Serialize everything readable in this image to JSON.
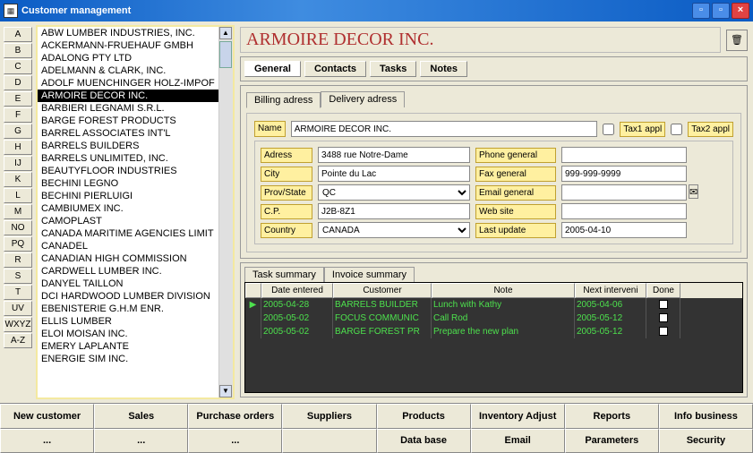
{
  "window": {
    "title": "Customer management"
  },
  "alphabet": [
    "A",
    "B",
    "C",
    "D",
    "E",
    "F",
    "G",
    "H",
    "IJ",
    "K",
    "L",
    "M",
    "NO",
    "PQ",
    "R",
    "S",
    "T",
    "UV",
    "WXYZ",
    "A-Z"
  ],
  "customers": [
    "ABW LUMBER INDUSTRIES, INC.",
    "ACKERMANN-FRUEHAUF GMBH",
    "ADALONG PTY LTD",
    "ADELMANN & CLARK, INC.",
    "ADOLF MUENCHINGER HOLZ-IMPOF",
    "ARMOIRE DECOR INC.",
    "BARBIERI LEGNAMI S.R.L.",
    "BARGE FOREST PRODUCTS",
    "BARREL ASSOCIATES INT'L",
    "BARRELS BUILDERS",
    "BARRELS UNLIMITED, INC.",
    "BEAUTYFLOOR INDUSTRIES",
    "BECHINI LEGNO",
    "BECHINI PIERLUIGI",
    "CAMBIUMEX INC.",
    "CAMOPLAST",
    "CANADA MARITIME AGENCIES LIMIT",
    "CANADEL",
    "CANADIAN HIGH COMMISSION",
    "CARDWELL LUMBER INC.",
    "DANYEL TAILLON",
    "DCI HARDWOOD LUMBER DIVISION",
    "EBENISTERIE G.H.M ENR.",
    "ELLIS LUMBER",
    "ELOI MOISAN INC.",
    "EMERY LAPLANTE",
    "ENERGIE SIM INC."
  ],
  "selected_index": 5,
  "company_name": "ARMOIRE DECOR INC.",
  "main_tabs": [
    "General",
    "Contacts",
    "Tasks",
    "Notes"
  ],
  "sub_tabs": [
    "Billing adress",
    "Delivery adress"
  ],
  "labels": {
    "name": "Name",
    "address": "Adress",
    "city": "City",
    "provstate": "Prov/State",
    "cp": "C.P.",
    "country": "Country",
    "phone": "Phone general",
    "fax": "Fax general",
    "email": "Email general",
    "web": "Web site",
    "lastupdate": "Last update",
    "tax1": "Tax1 appl",
    "tax2": "Tax2 appl"
  },
  "form": {
    "name": "ARMOIRE DECOR INC.",
    "address": "3488 rue Notre-Dame",
    "city": "Pointe du Lac",
    "provstate": "QC",
    "cp": "J2B-8Z1",
    "country": "CANADA",
    "phone": "",
    "fax": "999-999-9999",
    "email": "",
    "web": "",
    "lastupdate": "2005-04-10"
  },
  "task_tabs": [
    "Task summary",
    "Invoice summary"
  ],
  "task_columns": [
    "",
    "Date entered",
    "Customer",
    "Note",
    "Next interveni",
    "Done"
  ],
  "tasks": [
    {
      "date": "2005-04-28",
      "customer": "BARRELS BUILDER",
      "note": "Lunch with Kathy",
      "next": "2005-04-06",
      "done": false
    },
    {
      "date": "2005-05-02",
      "customer": "FOCUS COMMUNIC",
      "note": "Call Rod",
      "next": "2005-05-12",
      "done": false
    },
    {
      "date": "2005-05-02",
      "customer": "BARGE FOREST PR",
      "note": "Prepare the new plan",
      "next": "2005-05-12",
      "done": false
    }
  ],
  "bottom_row1": [
    "New customer",
    "Sales",
    "Purchase orders",
    "Suppliers",
    "Products",
    "Inventory Adjust",
    "Reports",
    "Info business"
  ],
  "bottom_row2": [
    "...",
    "...",
    "...",
    "",
    "Data base",
    "Email",
    "Parameters",
    "Security"
  ]
}
